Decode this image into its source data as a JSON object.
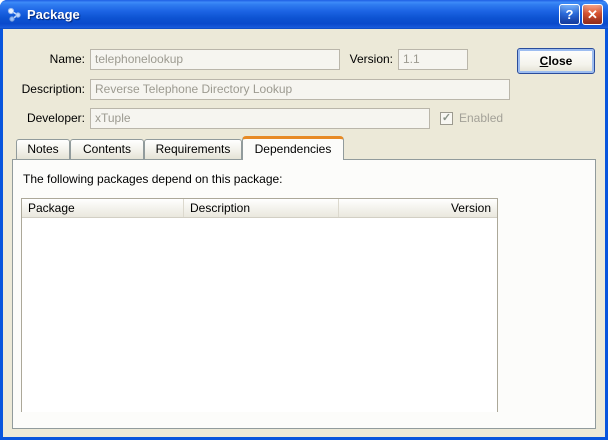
{
  "window": {
    "title": "Package"
  },
  "titlebar": {
    "help_glyph": "?",
    "close_glyph": "✕"
  },
  "form": {
    "name_label": "Name:",
    "name_value": "telephonelookup",
    "version_label": "Version:",
    "version_value": "1.1",
    "description_label": "Description:",
    "description_value": "Reverse Telephone Directory Lookup",
    "developer_label": "Developer:",
    "developer_value": "xTuple",
    "enabled_label": "Enabled",
    "enabled_checked": "✓"
  },
  "actions": {
    "close_accel": "C",
    "close_rest": "lose"
  },
  "tabs": [
    {
      "label": "Notes"
    },
    {
      "label": "Contents"
    },
    {
      "label": "Requirements"
    },
    {
      "label": "Dependencies"
    }
  ],
  "dependencies_tab": {
    "caption": "The following packages depend on this package:",
    "table": {
      "headers": [
        "Package",
        "Description",
        "Version"
      ],
      "rows": []
    }
  },
  "colors": {
    "titlebar_blue": "#0855DD",
    "dialog_background": "#ECE9D8",
    "active_tab_accent": "#E78A25",
    "disabled_text": "#9C9A90"
  }
}
